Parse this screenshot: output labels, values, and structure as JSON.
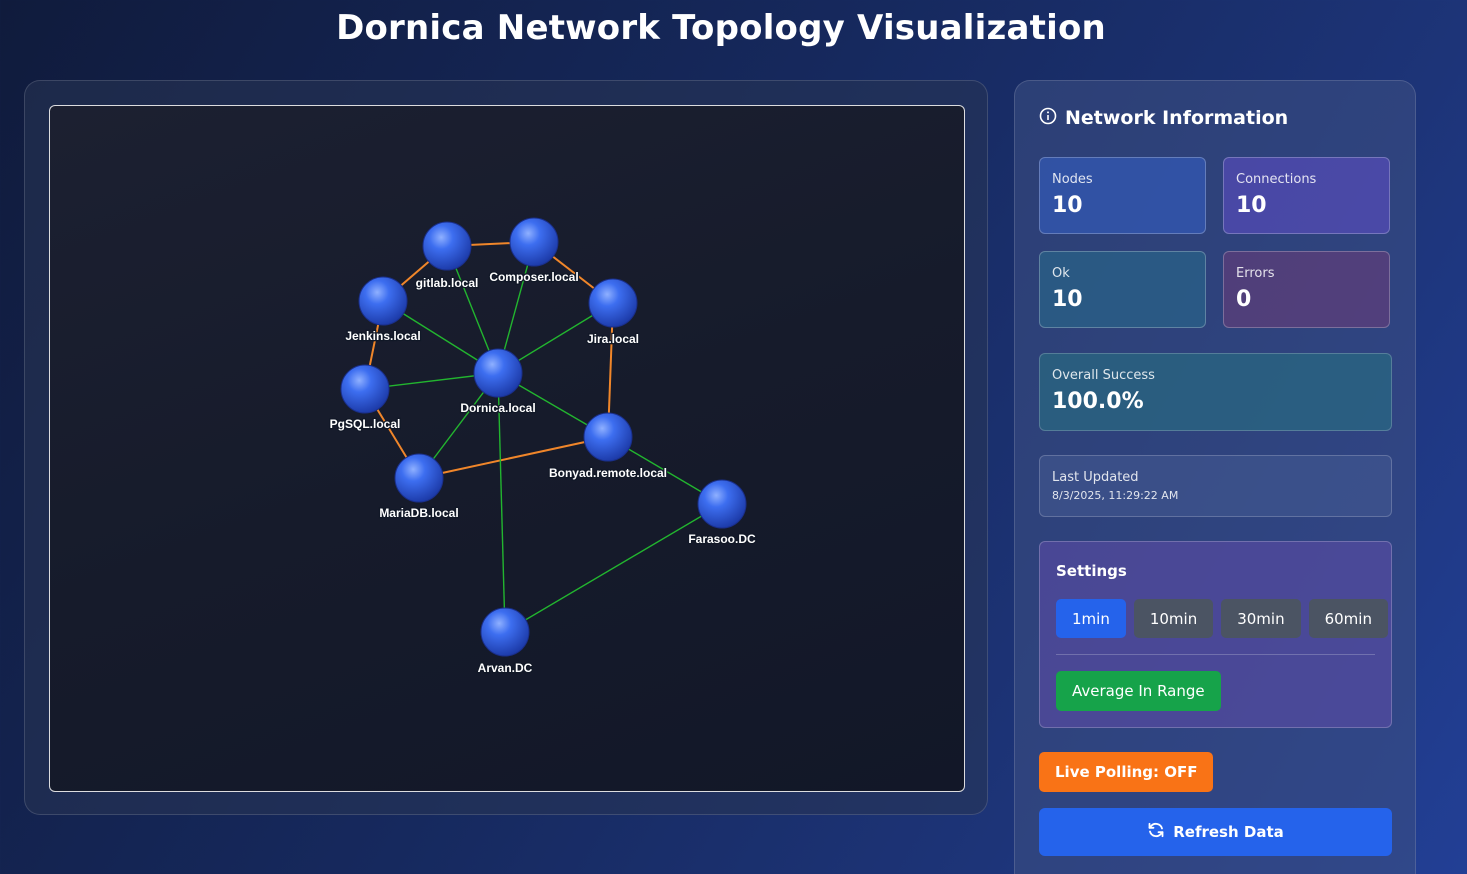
{
  "page": {
    "title": "Dornica Network Topology Visualization"
  },
  "graph": {
    "nodes": [
      {
        "id": "gitlab",
        "label": "gitlab.local"
      },
      {
        "id": "composer",
        "label": "Composer.local"
      },
      {
        "id": "jenkins",
        "label": "Jenkins.local"
      },
      {
        "id": "jira",
        "label": "Jira.local"
      },
      {
        "id": "dornica",
        "label": "Dornica.local"
      },
      {
        "id": "pgsql",
        "label": "PgSQL.local"
      },
      {
        "id": "bonyad",
        "label": "Bonyad.remote.local"
      },
      {
        "id": "mariadb",
        "label": "MariaDB.local"
      },
      {
        "id": "farasoo",
        "label": "Farasoo.DC"
      },
      {
        "id": "arvan",
        "label": "Arvan.DC"
      }
    ],
    "links": [
      {
        "source": "gitlab",
        "target": "composer",
        "kind": "orange"
      },
      {
        "source": "composer",
        "target": "jira",
        "kind": "orange"
      },
      {
        "source": "gitlab",
        "target": "jenkins",
        "kind": "orange"
      },
      {
        "source": "jira",
        "target": "bonyad",
        "kind": "orange"
      },
      {
        "source": "jenkins",
        "target": "pgsql",
        "kind": "orange"
      },
      {
        "source": "pgsql",
        "target": "mariadb",
        "kind": "orange"
      },
      {
        "source": "mariadb",
        "target": "bonyad",
        "kind": "orange"
      },
      {
        "source": "dornica",
        "target": "gitlab",
        "kind": "green"
      },
      {
        "source": "dornica",
        "target": "composer",
        "kind": "green"
      },
      {
        "source": "dornica",
        "target": "jenkins",
        "kind": "green"
      },
      {
        "source": "dornica",
        "target": "jira",
        "kind": "green"
      },
      {
        "source": "dornica",
        "target": "pgsql",
        "kind": "green"
      },
      {
        "source": "dornica",
        "target": "mariadb",
        "kind": "green"
      },
      {
        "source": "dornica",
        "target": "bonyad",
        "kind": "green"
      },
      {
        "source": "dornica",
        "target": "arvan",
        "kind": "green"
      },
      {
        "source": "bonyad",
        "target": "farasoo",
        "kind": "green"
      },
      {
        "source": "farasoo",
        "target": "arvan",
        "kind": "green"
      }
    ],
    "colors": {
      "orange": "#f0862a",
      "green": "#22b52f",
      "node": "#2f5fe0"
    }
  },
  "info": {
    "title": "Network Information",
    "icon": "info-icon",
    "stats": {
      "nodes": {
        "label": "Nodes",
        "value": "10"
      },
      "connections": {
        "label": "Connections",
        "value": "10"
      },
      "ok": {
        "label": "Ok",
        "value": "10"
      },
      "errors": {
        "label": "Errors",
        "value": "0"
      }
    },
    "success": {
      "label": "Overall Success",
      "value": "100.0%"
    },
    "last_updated": {
      "label": "Last Updated",
      "value": "8/3/2025, 11:29:22 AM"
    }
  },
  "settings": {
    "title": "Settings",
    "intervals": [
      "1min",
      "10min",
      "30min",
      "60min"
    ],
    "active_interval": "1min",
    "average_label": "Average In Range"
  },
  "polling": {
    "label": "Live Polling: OFF"
  },
  "refresh": {
    "label": "Refresh Data",
    "icon": "refresh-icon"
  }
}
